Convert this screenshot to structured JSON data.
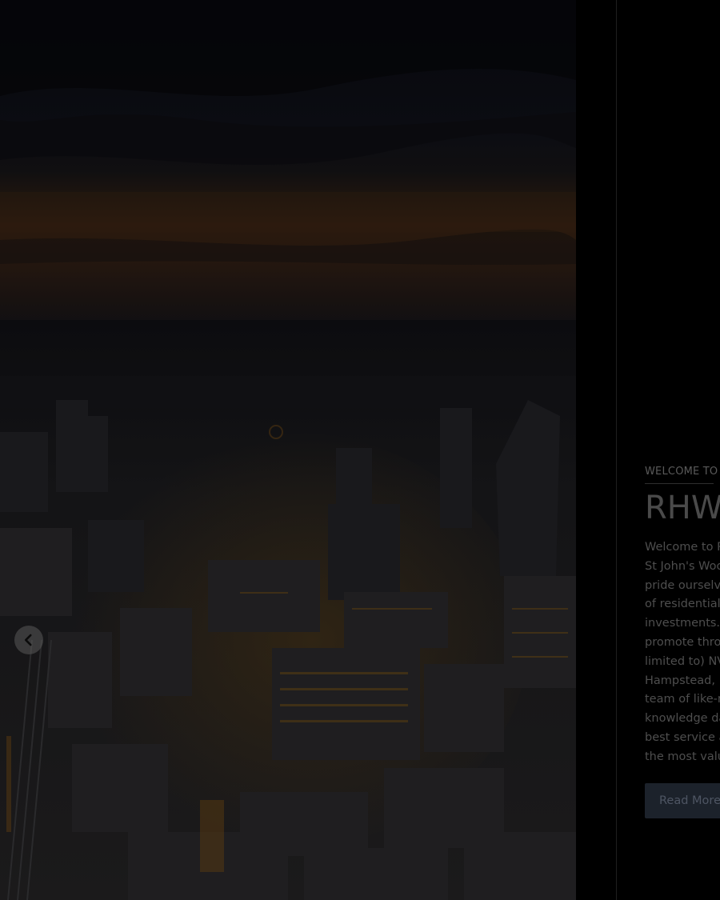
{
  "hero": {
    "prev_icon": "chevron-left-icon"
  },
  "welcome": {
    "eyebrow": "WELCOME TO",
    "title": "RHW",
    "intro_lines": [
      "Welcome to R",
      "St John's Woo",
      "pride ourselve",
      "of residential",
      "investments. I",
      "promote thro",
      "limited to) NV",
      "Hampstead, E",
      "team of like-m",
      "knowledge da",
      "best service a",
      "the most valu"
    ],
    "read_more_label": "Read More"
  },
  "colors": {
    "background": "#000000",
    "button_bg": "#1c222b",
    "text": "#4e4e4e"
  }
}
